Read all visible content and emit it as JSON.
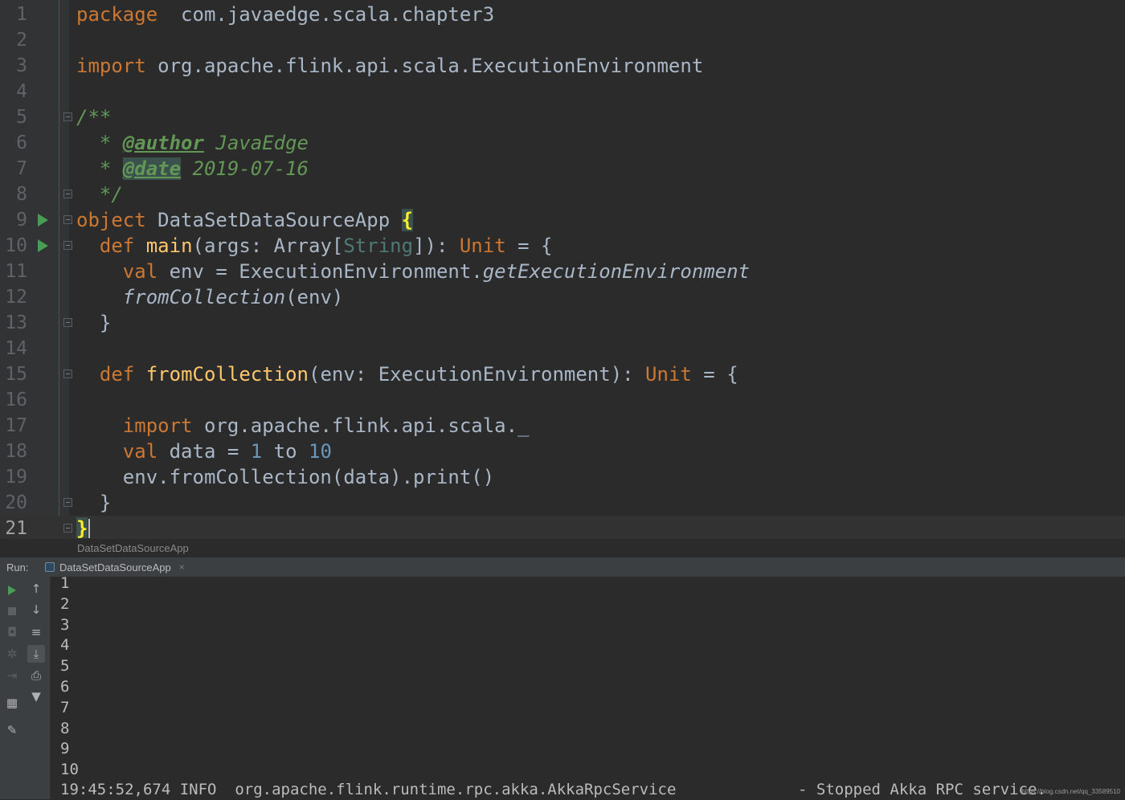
{
  "editor": {
    "current_line": "21",
    "lines": [
      {
        "n": "1",
        "tokens": [
          [
            "kw",
            "package"
          ],
          [
            "",
            "  com.javaedge.scala.chapter3"
          ]
        ]
      },
      {
        "n": "2",
        "tokens": []
      },
      {
        "n": "3",
        "tokens": [
          [
            "kw",
            "import"
          ],
          [
            "",
            " org.apache.flink.api.scala.ExecutionEnvironment"
          ]
        ]
      },
      {
        "n": "4",
        "tokens": []
      },
      {
        "n": "5",
        "tokens": [
          [
            "cm",
            "/**"
          ]
        ]
      },
      {
        "n": "6",
        "tokens": [
          [
            "cm",
            "  * "
          ],
          [
            "tag",
            "@author"
          ],
          [
            "cm",
            " JavaEdge"
          ]
        ]
      },
      {
        "n": "7",
        "tokens": [
          [
            "cm",
            "  * "
          ],
          [
            "tag hl",
            "@date"
          ],
          [
            "cm",
            " 2019-07-16"
          ]
        ]
      },
      {
        "n": "8",
        "tokens": [
          [
            "cm",
            "  */"
          ]
        ]
      },
      {
        "n": "9",
        "tokens": [
          [
            "kw",
            "object"
          ],
          [
            "",
            " DataSetDataSourceApp "
          ],
          [
            "brace-hl",
            "{"
          ]
        ]
      },
      {
        "n": "10",
        "tokens": [
          [
            "",
            "  "
          ],
          [
            "kw",
            "def"
          ],
          [
            "",
            " "
          ],
          [
            "fn",
            "main"
          ],
          [
            "",
            "(args: Array["
          ],
          [
            "type-param",
            "String"
          ],
          [
            "",
            "]): "
          ],
          [
            "kw",
            "Unit"
          ],
          [
            "",
            " = {"
          ]
        ]
      },
      {
        "n": "11",
        "tokens": [
          [
            "",
            "    "
          ],
          [
            "kw",
            "val"
          ],
          [
            "",
            " env = ExecutionEnvironment."
          ],
          [
            "it",
            "getExecutionEnvironment"
          ]
        ]
      },
      {
        "n": "12",
        "tokens": [
          [
            "",
            "    "
          ],
          [
            "it",
            "fromCollection"
          ],
          [
            "",
            "(env)"
          ]
        ]
      },
      {
        "n": "13",
        "tokens": [
          [
            "",
            "  }"
          ]
        ]
      },
      {
        "n": "14",
        "tokens": []
      },
      {
        "n": "15",
        "tokens": [
          [
            "",
            "  "
          ],
          [
            "kw",
            "def"
          ],
          [
            "",
            " "
          ],
          [
            "fn",
            "fromCollection"
          ],
          [
            "",
            "(env: ExecutionEnvironment): "
          ],
          [
            "kw",
            "Unit"
          ],
          [
            "",
            " = {"
          ]
        ]
      },
      {
        "n": "16",
        "tokens": []
      },
      {
        "n": "17",
        "tokens": [
          [
            "",
            "    "
          ],
          [
            "kw",
            "import"
          ],
          [
            "",
            " org.apache.flink.api.scala._"
          ]
        ]
      },
      {
        "n": "18",
        "tokens": [
          [
            "",
            "    "
          ],
          [
            "kw",
            "val"
          ],
          [
            "",
            " data = "
          ],
          [
            "num",
            "1"
          ],
          [
            "",
            " to "
          ],
          [
            "num",
            "10"
          ]
        ]
      },
      {
        "n": "19",
        "tokens": [
          [
            "",
            "    env.fromCollection(data).print()"
          ]
        ]
      },
      {
        "n": "20",
        "tokens": [
          [
            "",
            "  }"
          ]
        ]
      },
      {
        "n": "21",
        "tokens": [
          [
            "brace-hl",
            "}"
          ]
        ]
      }
    ]
  },
  "breadcrumb": "DataSetDataSourceApp",
  "run": {
    "label": "Run:",
    "tab_title": "DataSetDataSourceApp",
    "tab_close": "×",
    "output": [
      "1",
      "2",
      "3",
      "4",
      "5",
      "6",
      "7",
      "8",
      "9",
      "10"
    ],
    "log": {
      "left": "19:45:52,674 INFO  org.apache.flink.runtime.rpc.akka.AkkaRpcService",
      "right": "- Stopped Akka RPC service."
    }
  },
  "watermark": "https://blog.csdn.net/qq_33589510",
  "colors": {
    "background": "#2b2b2b",
    "keyword": "#cc7832",
    "function": "#ffc66d",
    "number": "#6897bb",
    "comment": "#629755",
    "text": "#a9b7c6",
    "run_green": "#499c54"
  }
}
